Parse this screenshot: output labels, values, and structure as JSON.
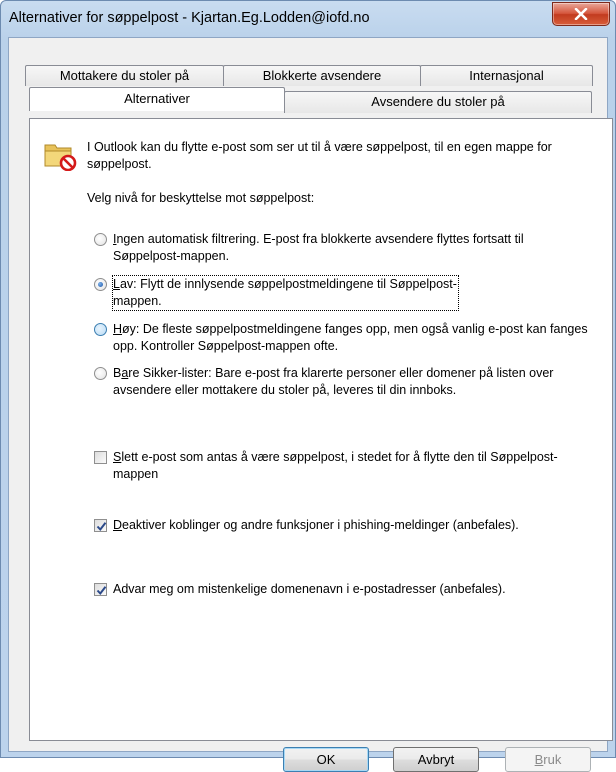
{
  "window": {
    "title": "Alternativer for søppelpost - Kjartan.Eg.Lodden@iofd.no"
  },
  "tabs": {
    "row1": [
      "Mottakere du stoler på",
      "Blokkerte avsendere",
      "Internasjonal"
    ],
    "row2": [
      "Alternativer",
      "Avsendere du stoler på"
    ],
    "active": "Alternativer"
  },
  "panel": {
    "intro": "I Outlook kan du flytte e-post som ser ut til å være søppelpost, til en egen mappe for søppelpost.",
    "level_label": "Velg nivå for beskyttelse mot søppelpost:",
    "radio_options": [
      {
        "key": "I",
        "rest": "ngen automatisk filtrering. E-post fra blokkerte avsendere flyttes fortsatt til Søppelpost-mappen.",
        "checked": false
      },
      {
        "key": "L",
        "rest": "av: Flytt de innlysende søppelpostmeldingene til Søppelpost-mappen.",
        "checked": true
      },
      {
        "key": "H",
        "rest": "øy: De fleste søppelpostmeldingene fanges opp, men også vanlig e-post kan fanges opp. Kontroller Søppelpost-mappen ofte.",
        "checked": false
      },
      {
        "pre": "B",
        "key": "a",
        "rest": "re Sikker-lister: Bare e-post fra klarerte personer eller domener på listen over avsendere eller mottakere du stoler på, leveres til din innboks.",
        "checked": false
      }
    ],
    "checkboxes": [
      {
        "key": "S",
        "rest": "lett e-post som antas å være søppelpost, i stedet for å flytte den til Søppelpost-mappen",
        "checked": false
      },
      {
        "key": "D",
        "rest": "eaktiver koblinger og andre funksjoner i phishing-meldinger (anbefales).",
        "checked": true
      },
      {
        "key": "",
        "rest": "Advar meg om mistenkelige domenenavn i e-postadresser (anbefales).",
        "checked": true
      }
    ]
  },
  "buttons": {
    "ok": "OK",
    "cancel": "Avbryt",
    "apply_key": "B",
    "apply_rest": "ruk"
  },
  "colors": {
    "title_gradient": "#c9dcf0",
    "close_red": "#d5553c",
    "accent_blue": "#3c7fb1"
  }
}
